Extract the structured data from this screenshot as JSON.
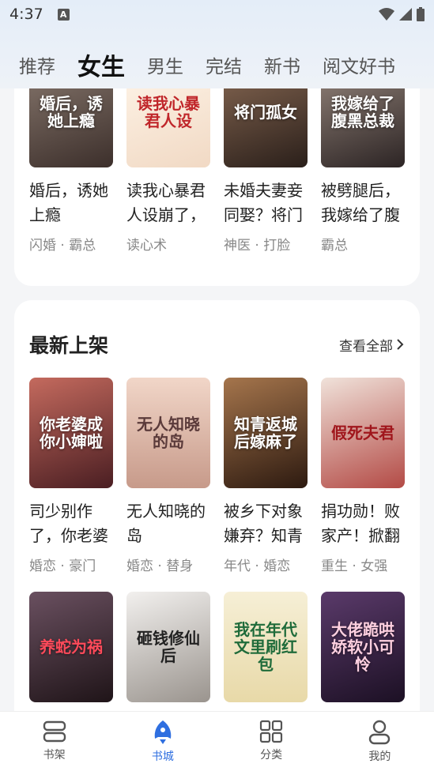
{
  "status_bar": {
    "time": "4:37"
  },
  "tabs": [
    "推荐",
    "女生",
    "男生",
    "完结",
    "新书",
    "阅文好书"
  ],
  "active_tab": "女生",
  "top_books": [
    {
      "title": "婚后，诱她上瘾",
      "tags": "闪婚 · 霸总",
      "cover_text": "婚后，诱她上瘾",
      "cover_color": "#5a4a44"
    },
    {
      "title": "读我心暴君人设崩了，",
      "tags": "读心术",
      "cover_text": "读我心暴君人设",
      "cover_color": "#f4efe8"
    },
    {
      "title": "未婚夫妻妾同娶？将门",
      "tags": "神医 · 打脸",
      "cover_text": "将门孤女",
      "cover_color": "#3a2f2a"
    },
    {
      "title": "被劈腿后，我嫁给了腹",
      "tags": "霸总",
      "cover_text": "我嫁给了腹黑总裁",
      "cover_color": "#4a4040"
    }
  ],
  "section": {
    "title": "最新上架",
    "see_all": "查看全部"
  },
  "new_books": [
    {
      "title": "司少别作了，你老婆",
      "tags": "婚恋 · 豪门",
      "cover_text": "你老婆成你小婶啦",
      "cover_color": "#7a3b3a"
    },
    {
      "title": "无人知晓的岛",
      "tags": "婚恋 · 替身",
      "cover_text": "无人知晓的岛",
      "cover_color": "#d9b9a8"
    },
    {
      "title": "被乡下对象嫌弃？知青",
      "tags": "年代 · 婚恋",
      "cover_text": "知青返城后嫁麻了",
      "cover_color": "#5b3a24"
    },
    {
      "title": "捐功勋！败家产！掀翻",
      "tags": "重生 · 女强",
      "cover_text": "假死夫君",
      "cover_color": "#d9c8c0"
    }
  ],
  "more_books": [
    {
      "cover_text": "养蛇为祸",
      "cover_color": "#3a2a35"
    },
    {
      "cover_text": "砸钱修仙后",
      "cover_color": "#e4e2df"
    },
    {
      "cover_text": "我在年代文里刷红包",
      "cover_color": "#f0e7c8"
    },
    {
      "cover_text": "大佬跪哄娇软小可怜",
      "cover_color": "#3a2540"
    }
  ],
  "bottom_nav": [
    {
      "label": "书架",
      "icon": "bookshelf-icon"
    },
    {
      "label": "书城",
      "icon": "rocket-icon"
    },
    {
      "label": "分类",
      "icon": "grid-icon"
    },
    {
      "label": "我的",
      "icon": "user-icon"
    }
  ],
  "colors": {
    "accent": "#2f6fe0",
    "page_bg": "#f4f5f7"
  }
}
